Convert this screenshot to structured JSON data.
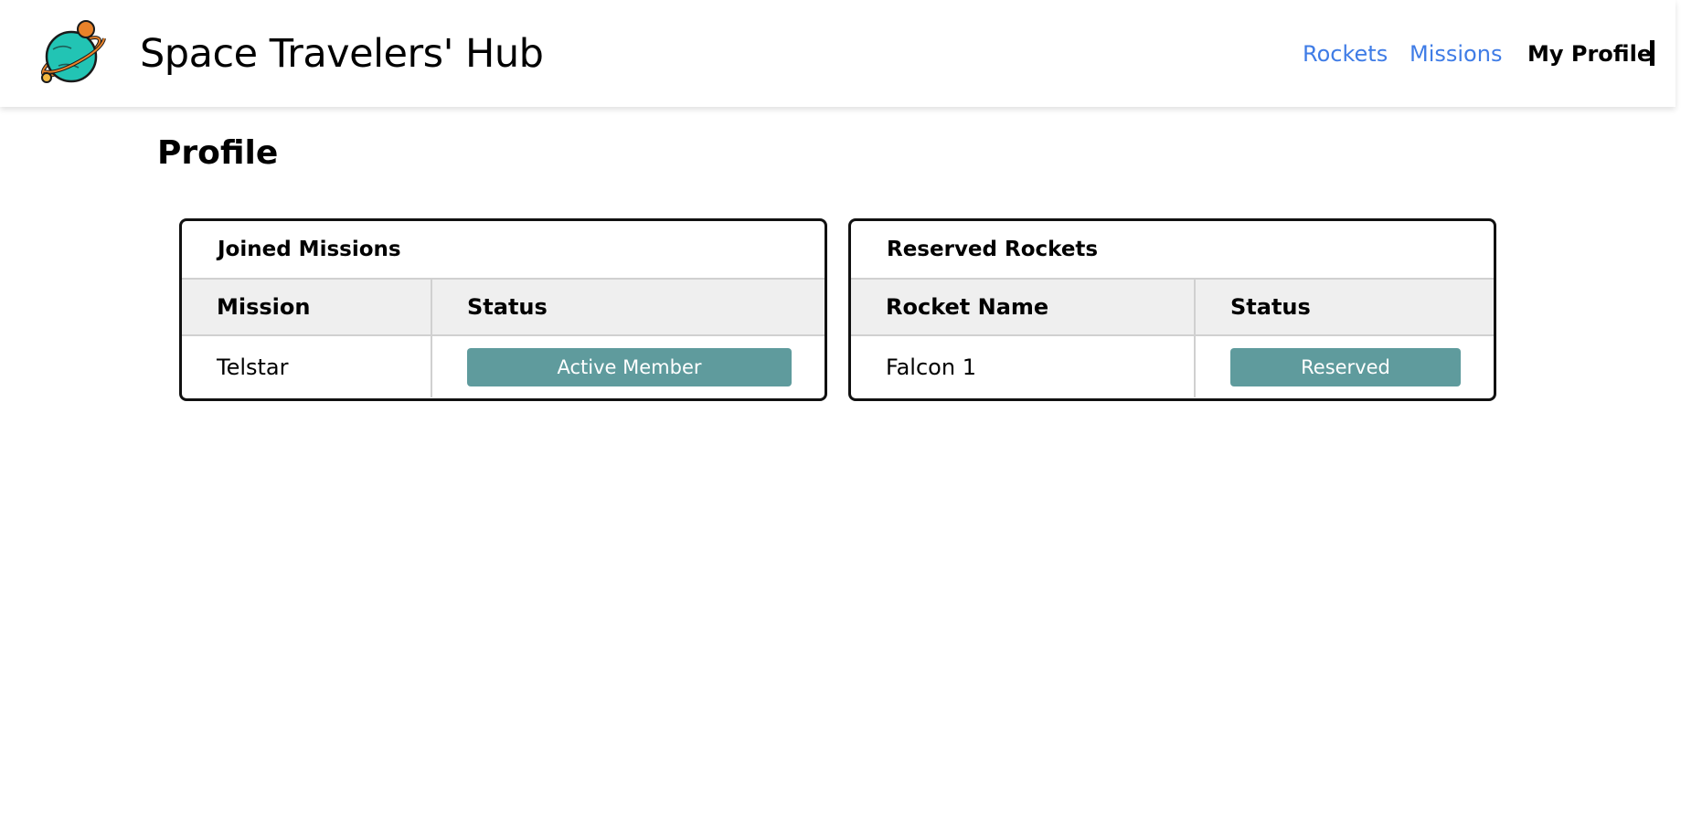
{
  "header": {
    "brand": "Space Travelers' Hub",
    "logo_icon": "planet-logo-icon",
    "nav": [
      {
        "label": "Rockets",
        "active": false
      },
      {
        "label": "Missions",
        "active": false
      },
      {
        "label": "My Profile",
        "active": true
      }
    ]
  },
  "page": {
    "title": "Profile"
  },
  "missions_panel": {
    "title": "Joined Missions",
    "columns": [
      "Mission",
      "Status"
    ],
    "rows": [
      {
        "name": "Telstar",
        "status": "Active Member"
      }
    ]
  },
  "rockets_panel": {
    "title": "Reserved Rockets",
    "columns": [
      "Rocket Name",
      "Status"
    ],
    "rows": [
      {
        "name": "Falcon 1",
        "status": "Reserved"
      }
    ]
  },
  "colors": {
    "nav_link": "#3f7ce6",
    "badge_bg": "#5f9b9d",
    "header_bg": "#efefef",
    "planet": "#22c4b4",
    "accent": "#e8822a"
  }
}
